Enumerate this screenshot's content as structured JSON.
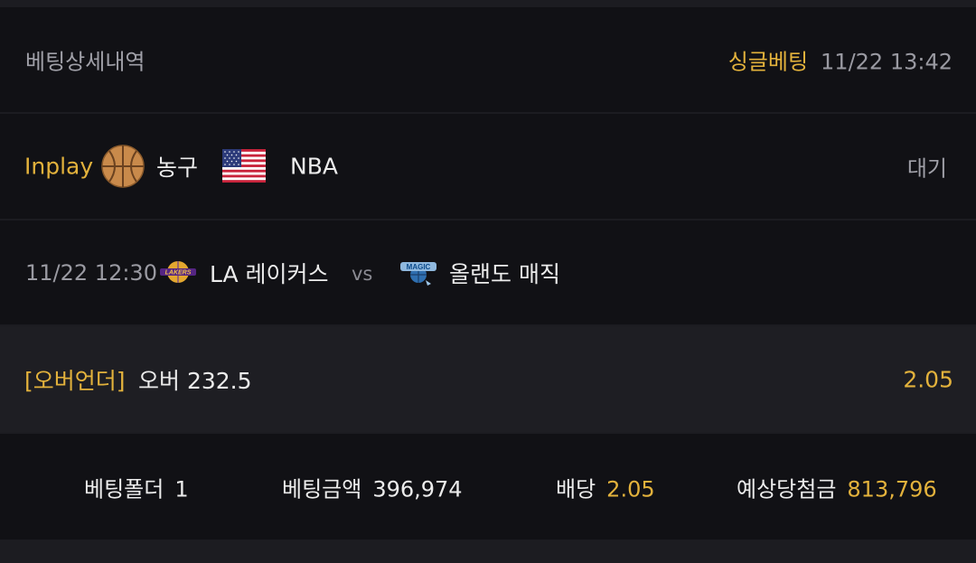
{
  "header": {
    "title": "베팅상세내역",
    "bet_type": "싱글베팅",
    "bet_time": "11/22 13:42"
  },
  "event": {
    "mode": "Inplay",
    "sport_icon": "basketball-icon",
    "sport": "농구",
    "flag_icon": "us-flag-icon",
    "league": "NBA",
    "status": "대기"
  },
  "match": {
    "time": "11/22 12:30",
    "home_logo": "lakers-logo-icon",
    "home": "LA 레이커스",
    "vs": "vs",
    "away_logo": "magic-logo-icon",
    "away": "올랜도 매직"
  },
  "selection": {
    "market": "[오버언더]",
    "pick": "오버 232.5",
    "odds": "2.05"
  },
  "summary": {
    "folder_label": "베팅폴더",
    "folder_value": "1",
    "amount_label": "베팅금액",
    "amount_value": "396,974",
    "odds_label": "배당",
    "odds_value": "2.05",
    "payout_label": "예상당첨금",
    "payout_value": "813,796"
  },
  "colors": {
    "accent": "#e3b23c",
    "panel": "#111115",
    "panel_highlight": "#1e1e23",
    "separator": "#1c1c21",
    "text": "#ececec",
    "muted": "#9a9aa2"
  }
}
